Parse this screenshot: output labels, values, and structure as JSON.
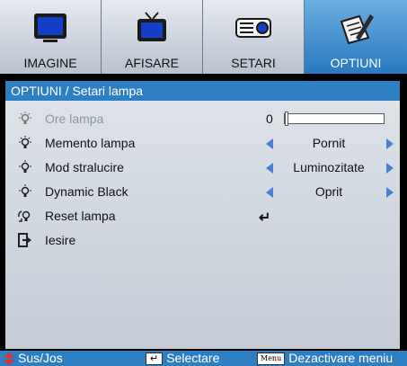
{
  "tabs": [
    {
      "label": "IMAGINE",
      "icon": "monitor-icon",
      "active": false
    },
    {
      "label": "AFISARE",
      "icon": "tv-icon",
      "active": false
    },
    {
      "label": "SETARI",
      "icon": "projector-icon",
      "active": false
    },
    {
      "label": "OPTIUNI",
      "icon": "pen-notepad-icon",
      "active": true
    }
  ],
  "breadcrumb": "OPTIUNI / Setari lampa",
  "items": [
    {
      "label": "Ore lampa",
      "icon": "lamp-icon",
      "value": "0",
      "slider_fraction": 0.0
    },
    {
      "label": "Memento lampa",
      "icon": "lamp-icon",
      "value": "Pornit"
    },
    {
      "label": "Mod stralucire",
      "icon": "lamp-icon",
      "value": "Luminozitate"
    },
    {
      "label": "Dynamic Black",
      "icon": "lamp-icon",
      "value": "Oprit"
    },
    {
      "label": "Reset lampa",
      "icon": "lamp-reset-icon",
      "value": "↵"
    },
    {
      "label": "Iesire",
      "icon": "exit-icon"
    }
  ],
  "footer": {
    "updown": "Sus/Jos",
    "select": "Selectare",
    "menu_key": "Menu",
    "exit": "Dezactivare meniu"
  },
  "colors": {
    "accent": "#2e7fc2",
    "active_tab": "#2a78bf",
    "arrow": "#4b7fd0"
  }
}
